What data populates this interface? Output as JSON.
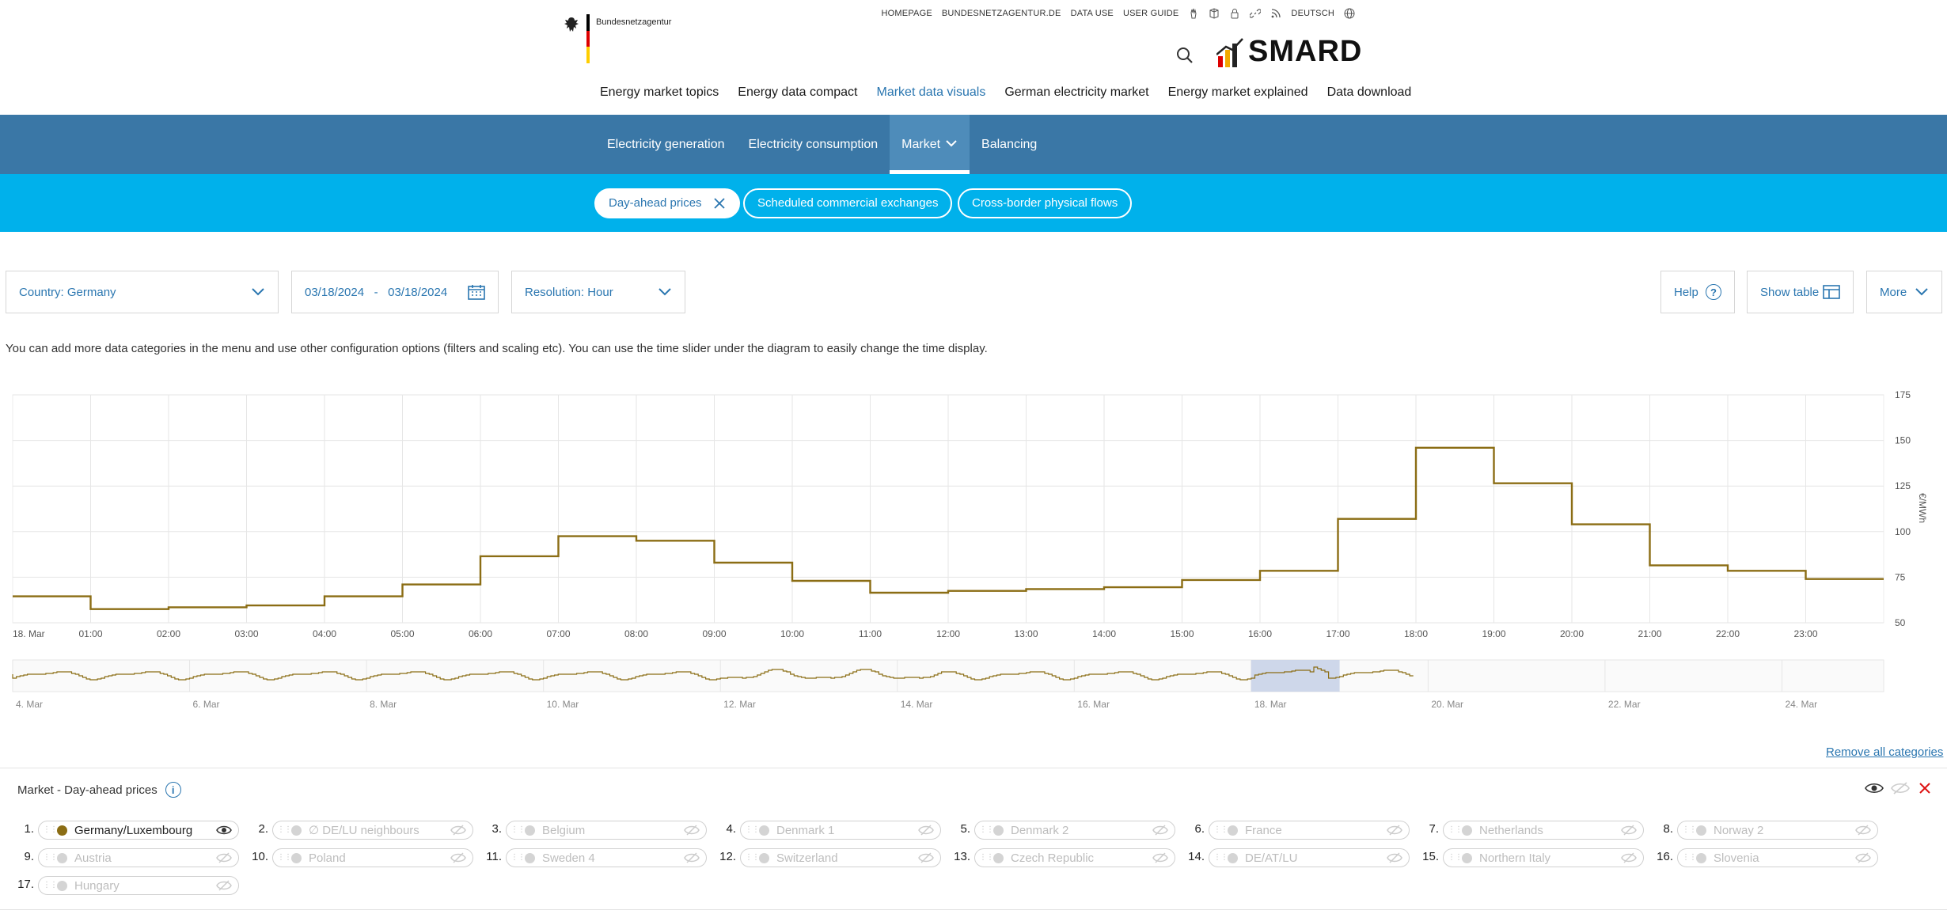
{
  "header": {
    "bn_name": "Bundesnetzagentur",
    "top_links": [
      "HOMEPAGE",
      "BUNDESNETZAGENTUR.DE",
      "DATA USE",
      "USER GUIDE"
    ],
    "language": "DEUTSCH",
    "brand": "SMARD",
    "flag_colors": [
      "#000000",
      "#dd0000",
      "#ffce00"
    ],
    "brand_bar_colors": [
      "#dd0000",
      "#f2a900",
      "#222222"
    ]
  },
  "main_nav": {
    "items": [
      "Energy market topics",
      "Energy data compact",
      "Market data visuals",
      "German electricity market",
      "Energy market explained",
      "Data download"
    ],
    "active_index": 2
  },
  "sub_nav": {
    "items": [
      "Electricity generation",
      "Electricity consumption",
      "Market",
      "Balancing"
    ],
    "active_index": 2
  },
  "pills": {
    "items": [
      "Day-ahead prices",
      "Scheduled commercial exchanges",
      "Cross-border physical flows"
    ],
    "active_index": 0
  },
  "controls": {
    "country": "Country: Germany",
    "date_from": "03/18/2024",
    "date_sep": "-",
    "date_to": "03/18/2024",
    "resolution": "Resolution: Hour",
    "help": "Help",
    "show_table": "Show table",
    "more": "More"
  },
  "info_text": "You can add more data categories in the menu and use other configuration options (filters and scaling etc). You can use the time slider under the diagram to easily change the time display.",
  "chart_data": {
    "type": "line",
    "step": true,
    "unit": "€/MWh",
    "x_tick_labels": [
      "18. Mar",
      "01:00",
      "02:00",
      "03:00",
      "04:00",
      "05:00",
      "06:00",
      "07:00",
      "08:00",
      "09:00",
      "10:00",
      "11:00",
      "12:00",
      "13:00",
      "14:00",
      "15:00",
      "16:00",
      "17:00",
      "18:00",
      "19:00",
      "20:00",
      "21:00",
      "22:00",
      "23:00"
    ],
    "y_ticks": [
      50,
      75,
      100,
      125,
      150,
      175
    ],
    "ylim": [
      50,
      175
    ],
    "grid": true,
    "series": [
      {
        "name": "Germany/Luxembourg",
        "color": "#8b6d14",
        "hours": [
          "00:00",
          "01:00",
          "02:00",
          "03:00",
          "04:00",
          "05:00",
          "06:00",
          "07:00",
          "08:00",
          "09:00",
          "10:00",
          "11:00",
          "12:00",
          "13:00",
          "14:00",
          "15:00",
          "16:00",
          "17:00",
          "18:00",
          "19:00",
          "20:00",
          "21:00",
          "22:00",
          "23:00"
        ],
        "values": [
          64.5,
          57.5,
          58.5,
          59.5,
          64.5,
          71.0,
          86.5,
          97.5,
          95.0,
          83.0,
          73.0,
          66.5,
          67.5,
          68.5,
          69.5,
          73.5,
          78.5,
          107.0,
          146.0,
          126.5,
          104.0,
          81.5,
          78.5,
          74.0
        ]
      }
    ],
    "navigator": {
      "x_tick_labels": [
        "4. Mar",
        "6. Mar",
        "8. Mar",
        "10. Mar",
        "12. Mar",
        "14. Mar",
        "16. Mar",
        "18. Mar",
        "20. Mar",
        "22. Mar",
        "24. Mar"
      ],
      "selected_range": [
        "18. Mar",
        "18. Mar"
      ],
      "selection_color": "#c9d3e8"
    }
  },
  "legend": {
    "remove_all": "Remove all categories",
    "title": "Market - Day-ahead prices",
    "items": [
      {
        "num": "1.",
        "label": "Germany/Luxembourg",
        "active": true
      },
      {
        "num": "2.",
        "label": "∅ DE/LU neighbours",
        "active": false
      },
      {
        "num": "3.",
        "label": "Belgium",
        "active": false
      },
      {
        "num": "4.",
        "label": "Denmark 1",
        "active": false
      },
      {
        "num": "5.",
        "label": "Denmark 2",
        "active": false
      },
      {
        "num": "6.",
        "label": "France",
        "active": false
      },
      {
        "num": "7.",
        "label": "Netherlands",
        "active": false
      },
      {
        "num": "8.",
        "label": "Norway 2",
        "active": false
      },
      {
        "num": "9.",
        "label": "Austria",
        "active": false
      },
      {
        "num": "10.",
        "label": "Poland",
        "active": false
      },
      {
        "num": "11.",
        "label": "Sweden 4",
        "active": false
      },
      {
        "num": "12.",
        "label": "Switzerland",
        "active": false
      },
      {
        "num": "13.",
        "label": "Czech Republic",
        "active": false
      },
      {
        "num": "14.",
        "label": "DE/AT/LU",
        "active": false
      },
      {
        "num": "15.",
        "label": "Northern Italy",
        "active": false
      },
      {
        "num": "16.",
        "label": "Slovenia",
        "active": false
      },
      {
        "num": "17.",
        "label": "Hungary",
        "active": false
      }
    ]
  }
}
